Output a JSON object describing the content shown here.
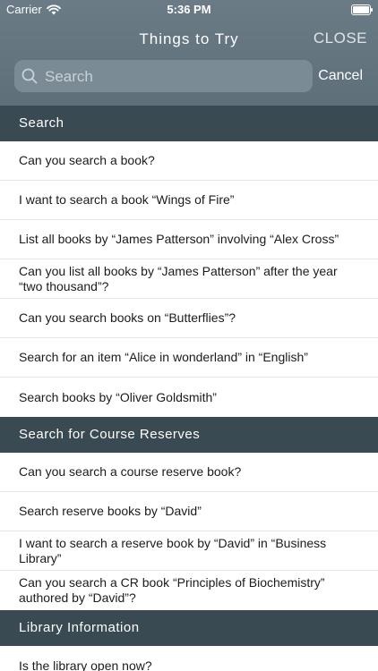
{
  "status_bar": {
    "carrier": "Carrier",
    "time": "5:36 PM"
  },
  "header": {
    "title": "Things to Try",
    "close_label": "CLOSE"
  },
  "search": {
    "placeholder": "Search",
    "value": "",
    "cancel_label": "Cancel"
  },
  "colors": {
    "header_bg": "#5e6f7a",
    "section_bg": "#3a4a52",
    "search_bg": "#7b8b95"
  },
  "sections": [
    {
      "title": "Search",
      "items": [
        "Can you search a book?",
        "I want to search a book “Wings of Fire”",
        "List all books by “James Patterson” involving “Alex Cross”",
        "Can you list all books by “James Patterson” after the year “two thousand”?",
        "Can you search books on “Butterflies”?",
        "Search for an item “Alice in wonderland” in “English”",
        "Search books by “Oliver Goldsmith”"
      ]
    },
    {
      "title": "Search for Course Reserves",
      "items": [
        "Can you search a course reserve book?",
        "Search reserve books by “David”",
        "I want to search a reserve book by “David” in “Business Library”",
        "Can you search a CR book “Principles of Biochemistry” authored by “David”?"
      ]
    },
    {
      "title": "Library Information",
      "items": [
        "Is the library open now?"
      ]
    }
  ]
}
